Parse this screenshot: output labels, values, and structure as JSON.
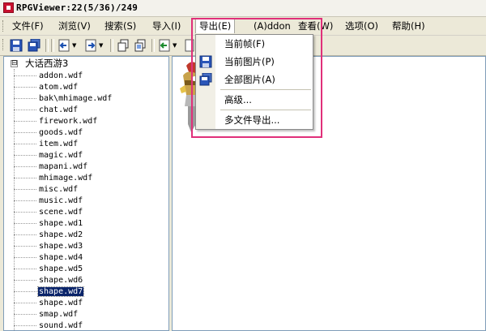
{
  "window": {
    "title": "RPGViewer:22(5/36)/249",
    "icon": "app-icon"
  },
  "menubar": {
    "items": [
      {
        "label": "文件(F)"
      },
      {
        "label": "浏览(V)"
      },
      {
        "label": "搜索(S)"
      },
      {
        "label": "导入(I)"
      },
      {
        "label": "导出(E)",
        "active": true
      },
      {
        "label": "(A)ddon"
      },
      {
        "label": "查看(W)"
      },
      {
        "label": "选项(O)"
      },
      {
        "label": "帮助(H)"
      }
    ]
  },
  "toolbar": {
    "buttons": [
      "save-icon",
      "save-all-icon",
      "back-icon",
      "forward-icon",
      "copy-icon",
      "copy-all-icon",
      "export-icon",
      "export-all-icon"
    ]
  },
  "export_menu": {
    "items": [
      {
        "label": "当前帧(F)",
        "icon": ""
      },
      {
        "label": "当前图片(P)",
        "icon": "save-icon"
      },
      {
        "label": "全部图片(A)",
        "icon": "save-all-icon"
      },
      {
        "label": "高级...",
        "icon": ""
      },
      {
        "label": "多文件导出...",
        "icon": ""
      }
    ]
  },
  "tree": {
    "root": {
      "label": "大话西游3",
      "expander": "⊟"
    },
    "items": [
      "addon.wdf",
      "atom.wdf",
      "bak\\mhimage.wdf",
      "chat.wdf",
      "firework.wdf",
      "goods.wdf",
      "item.wdf",
      "magic.wdf",
      "mapani.wdf",
      "mhimage.wdf",
      "misc.wdf",
      "music.wdf",
      "scene.wdf",
      "shape.wd1",
      "shape.wd2",
      "shape.wd3",
      "shape.wd4",
      "shape.wd5",
      "shape.wd6",
      "shape.wd7",
      "shape.wdf",
      "smap.wdf",
      "sound.wdf"
    ],
    "selected": "shape.wd7"
  },
  "colors": {
    "highlight_box": "#e0307a",
    "selection": "#0a246a",
    "menu_bg": "#ece9d8"
  }
}
